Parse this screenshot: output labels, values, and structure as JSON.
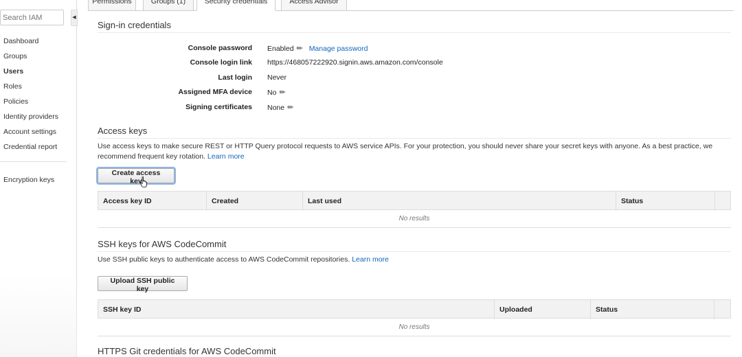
{
  "sidebar": {
    "search_placeholder": "Search IAM",
    "items": [
      {
        "label": "Dashboard"
      },
      {
        "label": "Groups"
      },
      {
        "label": "Users"
      },
      {
        "label": "Roles"
      },
      {
        "label": "Policies"
      },
      {
        "label": "Identity providers"
      },
      {
        "label": "Account settings"
      },
      {
        "label": "Credential report"
      }
    ],
    "encryption_label": "Encryption keys"
  },
  "tabs": [
    {
      "label": "Permissions"
    },
    {
      "label": "Groups (1)"
    },
    {
      "label": "Security credentials"
    },
    {
      "label": "Access Advisor"
    }
  ],
  "signin": {
    "title": "Sign-in credentials",
    "rows": [
      {
        "label": "Console password",
        "value": "Enabled",
        "link": "Manage password"
      },
      {
        "label": "Console login link",
        "value": "https://468057222920.signin.aws.amazon.com/console"
      },
      {
        "label": "Last login",
        "value": "Never"
      },
      {
        "label": "Assigned MFA device",
        "value": "No"
      },
      {
        "label": "Signing certificates",
        "value": "None"
      }
    ]
  },
  "access_keys": {
    "title": "Access keys",
    "description": "Use access keys to make secure REST or HTTP Query protocol requests to AWS service APIs. For your protection, you should never share your secret keys with anyone. As a best practice, we recommend frequent key rotation.",
    "learn_more": "Learn more",
    "button": "Create access key",
    "columns": [
      "Access key ID",
      "Created",
      "Last used",
      "Status"
    ],
    "empty": "No results"
  },
  "ssh_keys": {
    "title": "SSH keys for AWS CodeCommit",
    "description": "Use SSH public keys to authenticate access to AWS CodeCommit repositories.",
    "learn_more": "Learn more",
    "button": "Upload SSH public key",
    "columns": [
      "SSH key ID",
      "Uploaded",
      "Status"
    ],
    "empty": "No results"
  },
  "https_git": {
    "title": "HTTPS Git credentials for AWS CodeCommit"
  },
  "icons": {
    "pencil": "pencil-icon",
    "collapse": "chevron-left-icon",
    "cursor": "hand-cursor-icon"
  },
  "colors": {
    "link": "#1166bb",
    "focus": "#8db6e6"
  }
}
